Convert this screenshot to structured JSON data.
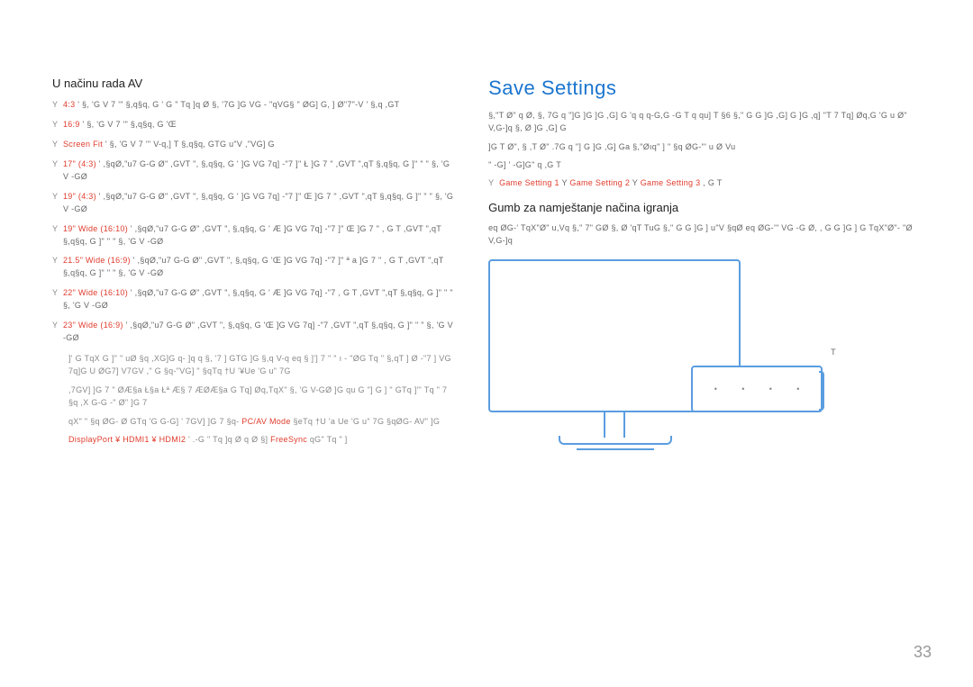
{
  "left": {
    "heading": "U načinu rada AV",
    "items": [
      {
        "ratio": "4:3",
        "text": "' §, 'G V 7 '\" §,q§q, G ' G \" Tq ]q Ø §, '7G ]G VG - \"qVG§ \" ØG] G, ] Ø\"7\"-V ' §,q ,GT"
      },
      {
        "ratio": "16:9",
        "text": "' §, 'G V 7 '\" §,q§q, G 'Œ"
      },
      {
        "ratio": "Screen Fit",
        "text": "' §, 'G V 7 '\" V-q,] T §,q§q, GTG u\"V ,\"VG] G"
      },
      {
        "ratio": "17\" (4:3)",
        "text": "' ,§qØ,\"u7 G-G Ø\" ,GVT \", §,q§q, G ' ]G VG 7q] -\"7 ]\" Ł ]G 7 \" ,GVT \",qT §,q§q, G ]\" \" \" §, 'G V -GØ"
      },
      {
        "ratio": "19\" (4:3)",
        "text": "' ,§qØ,\"u7 G-G Ø\" ,GVT \", §,q§q, G ' ]G VG 7q] -\"7 ]\" Œ ]G 7 \" ,GVT \",qT §,q§q, G ]\" \" \" §, 'G V -GØ"
      },
      {
        "ratio": "19\" Wide (16:10)",
        "text": "' ,§qØ,\"u7 G-G Ø\" ,GVT \", §,q§q, G ' Æ ]G VG 7q] -\"7 ]\" Œ ]G 7 \" , G T ,GVT \",qT §,q§q, G ]\" \" \" §, 'G V -GØ"
      },
      {
        "ratio": "21.5\" Wide (16:9)",
        "text": "' ,§qØ,\"u7 G-G Ø\" ,GVT \", §,q§q, G 'Œ ]G VG 7q] -\"7 ]\" ª a ]G 7 \" , G T ,GVT \",qT §,q§q, G ]\" \" \" §, 'G V -GØ"
      },
      {
        "ratio": "22\" Wide (16:10)",
        "text": "' ,§qØ,\"u7 G-G Ø\" ,GVT \", §,q§q, G ' Æ ]G VG 7q] -\"7 , G T ,GVT \",qT §,q§q, G ]\" \" \" §, 'G V -GØ"
      },
      {
        "ratio": "23\" Wide (16:9)",
        "text": "' ,§qØ,\"u7 G-G Ø\" ,GVT \", §,q§q, G 'Œ ]G VG 7q] -\"7 ,GVT \",qT §,q§q, G ]\" \" \" §, 'G V -GØ"
      }
    ],
    "note1": "]' G TqX G ]\" \" uØ §q ,XG]G q- ]q q §, '7 ] GTG ]G §,q V-q eq § ]'] 7 \" \" ı - \"ØG Tq \" §,qT ] Ø -\"7 ] VG 7q]G U ØG7] V7GV ,\" G §q-\"VG] \" §qTq †U '¥Ue 'G u\" 7G",
    "note2": ",7GV] ]G 7 \" ØÆ§a Ł§a Łª Æ§ 7 ÆØÆ§a G Tq] Øq,TqX\" §, 'G V-GØ ]G qu G \"] G ] \" GTq ]\"' Tq \" 7 §q ,X G-G -\" Ø\" ]G 7",
    "note3_prefix": "qX\" \" §q ØG- Ø GTq 'G G-G] ' 7GV] ]G 7 §q-",
    "note3_red": "PC/AV Mode",
    "note3_suffix": "§eTq †U 'a Ue 'G u\" 7G §qØG- AV\" ]G",
    "note4_ports": "DisplayPort ¥ HDMI1 ¥ HDMI2",
    "note4_middle": "' .-G \" Tq ]q Ø q Ø §]",
    "note4_red": "FreeSync",
    "note4_suffix": "qG\" Tq \" ]"
  },
  "right": {
    "title": "Save Settings",
    "desc1": "§,\"T Ø\" q Ø, §, 7G q \"]G ]G ]G ,G] G 'q q q-G,G -G T q qu] T §6 §,\" G G ]G ,G] G ]G ,q] \"T 7 Tq] Øq,G 'G u Ø\" V,G-]q §, Ø ]G ,G] G",
    "desc2": "]G T Ø\", § ,T Ø\" .7G q \"] G ]G ,G] Ga §,\"Øıq\" ] \" §q ØG-\"' u Ø Vu",
    "desc3_prefix": "\" -G] ' -G]G\" q ,G T",
    "desc3_settings": [
      "Game Setting 1",
      "Game Setting 2",
      "Game Setting 3"
    ],
    "desc3_suffix": ", G T",
    "subheading": "Gumb za namještanje načina igranja",
    "body1": "eq ØG-' TqX\"Ø\" u,Vq §,\" 7\" GØ §, Ø 'qT TuG §,\" G G ]G ] u\"V §qØ eq ØG-'\" VG -G Ø, , G G ]G ] G TqX\"Ø\"- \"Ø V,G-]q"
  },
  "pageNumber": "33"
}
